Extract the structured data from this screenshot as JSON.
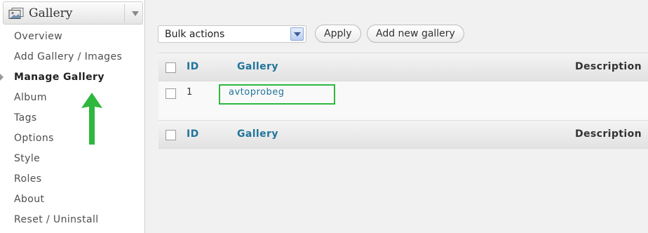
{
  "sidebar": {
    "title": "Gallery",
    "icon": "gallery-icon",
    "items": [
      {
        "label": "Overview"
      },
      {
        "label": "Add Gallery / Images"
      },
      {
        "label": "Manage Gallery",
        "current": true
      },
      {
        "label": "Album"
      },
      {
        "label": "Tags"
      },
      {
        "label": "Options"
      },
      {
        "label": "Style"
      },
      {
        "label": "Roles"
      },
      {
        "label": "About"
      },
      {
        "label": "Reset / Uninstall"
      }
    ]
  },
  "toolbar": {
    "bulk_select_value": "Bulk actions",
    "apply_label": "Apply",
    "add_new_label": "Add new gallery"
  },
  "table": {
    "columns": {
      "id": "ID",
      "gallery": "Gallery",
      "description": "Description"
    },
    "rows": [
      {
        "id": "1",
        "gallery": "avtoprobeg",
        "description": ""
      }
    ]
  },
  "colors": {
    "link": "#21759b",
    "annotation": "#2fb73e"
  }
}
